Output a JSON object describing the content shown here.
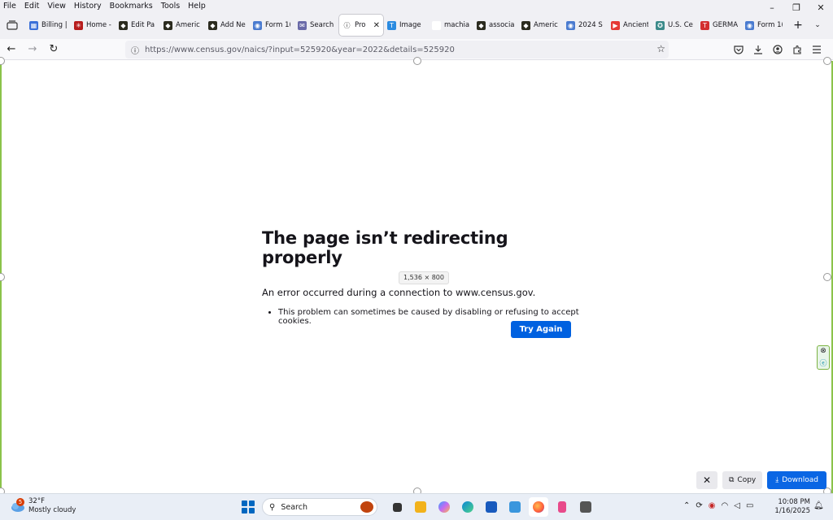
{
  "menu": [
    "File",
    "Edit",
    "View",
    "History",
    "Bookmarks",
    "Tools",
    "Help"
  ],
  "window_controls": [
    "–",
    "❐",
    "✕"
  ],
  "tabs": [
    {
      "label": "Billing |",
      "color": "#3a6fd8",
      "glyph": "▦"
    },
    {
      "label": "Home -",
      "color": "#b71c1c",
      "glyph": "✳"
    },
    {
      "label": "Edit Pa",
      "color": "#2b2b1f",
      "glyph": "◆"
    },
    {
      "label": "Americ",
      "color": "#2b2b1f",
      "glyph": "◆"
    },
    {
      "label": "Add Ne",
      "color": "#2b2b1f",
      "glyph": "◆"
    },
    {
      "label": "Form 1(",
      "color": "#4a7bd0",
      "glyph": "◉"
    },
    {
      "label": "Search",
      "color": "#6a6aa8",
      "glyph": "✉"
    },
    {
      "label": "Pro",
      "color": "#ffffff",
      "glyph": "ⓘ",
      "active": true
    },
    {
      "label": "Image",
      "color": "#2b8be0",
      "glyph": "T"
    },
    {
      "label": "machia",
      "color": "#ffffff",
      "glyph": ""
    },
    {
      "label": "associa",
      "color": "#2b2b1f",
      "glyph": "◆"
    },
    {
      "label": "Americ",
      "color": "#2b2b1f",
      "glyph": "◆"
    },
    {
      "label": "2024 S",
      "color": "#4a7bd0",
      "glyph": "◉"
    },
    {
      "label": "Ancient",
      "color": "#e53935",
      "glyph": "▶"
    },
    {
      "label": "U.S. Ce",
      "color": "#3b8a8a",
      "glyph": "✪"
    },
    {
      "label": "GERMA",
      "color": "#d32f2f",
      "glyph": "T"
    },
    {
      "label": "Form 1(",
      "color": "#4a7bd0",
      "glyph": "◉"
    }
  ],
  "tab_close": "✕",
  "new_tab": "+",
  "list_tabs": "⌄",
  "nav": {
    "back": "←",
    "forward": "→",
    "reload": "↻"
  },
  "url": "https://www.census.gov/naics/?input=525920&year=2022&details=525920",
  "error": {
    "title": "The page isn’t redirecting properly",
    "message": "An error occurred during a connection to www.census.gov.",
    "bullet": "This problem can sometimes be caused by disabling or refusing to accept cookies.",
    "button": "Try Again"
  },
  "dimension_tip": "1,536 × 800",
  "download_bar": {
    "close": "✕",
    "copy": "Copy",
    "download": "Download"
  },
  "taskbar": {
    "weather_temp": "32°F",
    "weather_desc": "Mostly cloudy",
    "weather_badge": "5",
    "search_label": "Search",
    "time": "10:08 PM",
    "date": "1/16/2025"
  },
  "colors": {
    "accent": "#0061e0",
    "selection_border": "#8bc34a"
  }
}
